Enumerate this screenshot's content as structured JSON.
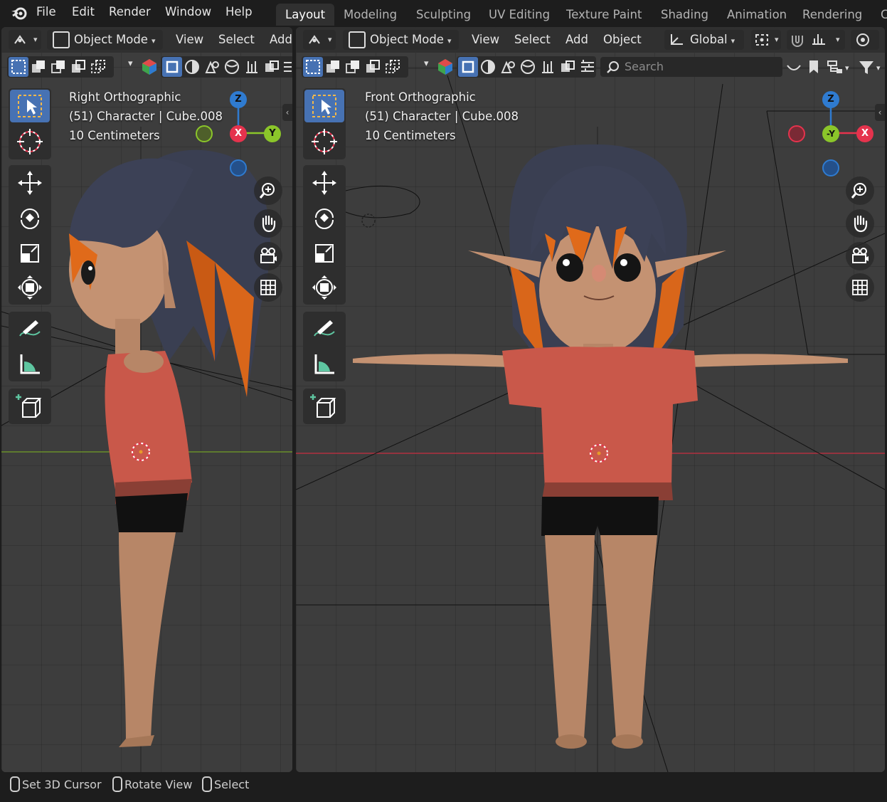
{
  "menu": {
    "items": [
      "File",
      "Edit",
      "Render",
      "Window",
      "Help"
    ]
  },
  "workspaces": {
    "tabs": [
      "Layout",
      "Modeling",
      "Sculpting",
      "UV Editing",
      "Texture Paint",
      "Shading",
      "Animation",
      "Rendering",
      "C"
    ],
    "active": "Layout"
  },
  "left_view": {
    "mode": "Object Mode",
    "menus": [
      "View",
      "Select",
      "Add"
    ],
    "view_name": "Right Orthographic",
    "object_info": "(51) Character | Cube.008",
    "scale": "10 Centimeters",
    "gizmo": {
      "top": "Z",
      "center": "X",
      "right": "Y"
    }
  },
  "right_view": {
    "mode": "Object Mode",
    "menus": [
      "View",
      "Select",
      "Add",
      "Object"
    ],
    "orientation": "Global",
    "search_placeholder": "Search",
    "view_name": "Front Orthographic",
    "object_info": "(51) Character | Cube.008",
    "scale": "10 Centimeters",
    "gizmo": {
      "top": "Z",
      "center": "-Y",
      "right": "X"
    }
  },
  "status": {
    "items": [
      "Set 3D Cursor",
      "Rotate View",
      "Select"
    ]
  },
  "colors": {
    "accent": "#4772b3",
    "axis_x": "#e5334d",
    "axis_y": "#8bc62a",
    "axis_z": "#2f7bd0",
    "shirt": "#c9584a",
    "skin": "#b78667",
    "hair": "#3a3f52",
    "hair_orange": "#e06a1a"
  }
}
